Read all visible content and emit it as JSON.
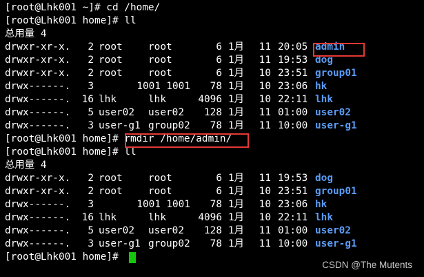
{
  "colors": {
    "background": "#000000",
    "foreground": "#ffffff",
    "directory": "#5b9cf5",
    "highlight_box": "#e53935",
    "cursor": "#16c60c"
  },
  "lines": {
    "l1": "[root@Lhk001 ~]# cd /home/",
    "l2": "[root@Lhk001 home]# ll",
    "l3": "总用量 4",
    "l11": "[root@Lhk001 home]# ",
    "l11_cmd": "rmdir /home/admin/",
    "l12": "[root@Lhk001 home]# ll",
    "l13": "总用量 4",
    "l20": "[root@Lhk001 home]# "
  },
  "listing1": [
    {
      "perm": "drwxr-xr-x.",
      "links": "2",
      "owner": "root",
      "group": "root",
      "size": "6",
      "month": "1月",
      "day": "11",
      "time": "20:05",
      "name": "admin"
    },
    {
      "perm": "drwxr-xr-x.",
      "links": "2",
      "owner": "root",
      "group": "root",
      "size": "6",
      "month": "1月",
      "day": "11",
      "time": "19:53",
      "name": "dog"
    },
    {
      "perm": "drwxr-xr-x.",
      "links": "2",
      "owner": "root",
      "group": "root",
      "size": "6",
      "month": "1月",
      "day": "10",
      "time": "23:51",
      "name": "group01"
    },
    {
      "perm": "drwx------.",
      "links": "3",
      "owner": "1001",
      "group": "1001",
      "size": "78",
      "month": "1月",
      "day": "10",
      "time": "23:06",
      "name": "hk"
    },
    {
      "perm": "drwx------.",
      "links": "16",
      "owner": "lhk",
      "group": "lhk",
      "size": "4096",
      "month": "1月",
      "day": "10",
      "time": "22:11",
      "name": "lhk"
    },
    {
      "perm": "drwx------.",
      "links": "5",
      "owner": "user02",
      "group": "user02",
      "size": "128",
      "month": "1月",
      "day": "11",
      "time": "01:00",
      "name": "user02"
    },
    {
      "perm": "drwx------.",
      "links": "3",
      "owner": "user-g1",
      "group": "group02",
      "size": "78",
      "month": "1月",
      "day": "11",
      "time": "10:00",
      "name": "user-g1"
    }
  ],
  "listing2": [
    {
      "perm": "drwxr-xr-x.",
      "links": "2",
      "owner": "root",
      "group": "root",
      "size": "6",
      "month": "1月",
      "day": "11",
      "time": "19:53",
      "name": "dog"
    },
    {
      "perm": "drwxr-xr-x.",
      "links": "2",
      "owner": "root",
      "group": "root",
      "size": "6",
      "month": "1月",
      "day": "10",
      "time": "23:51",
      "name": "group01"
    },
    {
      "perm": "drwx------.",
      "links": "3",
      "owner": "1001",
      "group": "1001",
      "size": "78",
      "month": "1月",
      "day": "10",
      "time": "23:06",
      "name": "hk"
    },
    {
      "perm": "drwx------.",
      "links": "16",
      "owner": "lhk",
      "group": "lhk",
      "size": "4096",
      "month": "1月",
      "day": "10",
      "time": "22:11",
      "name": "lhk"
    },
    {
      "perm": "drwx------.",
      "links": "5",
      "owner": "user02",
      "group": "user02",
      "size": "128",
      "month": "1月",
      "day": "11",
      "time": "01:00",
      "name": "user02"
    },
    {
      "perm": "drwx------.",
      "links": "3",
      "owner": "user-g1",
      "group": "group02",
      "size": "78",
      "month": "1月",
      "day": "11",
      "time": "10:00",
      "name": "user-g1"
    }
  ],
  "watermark": "CSDN @The Mutents"
}
